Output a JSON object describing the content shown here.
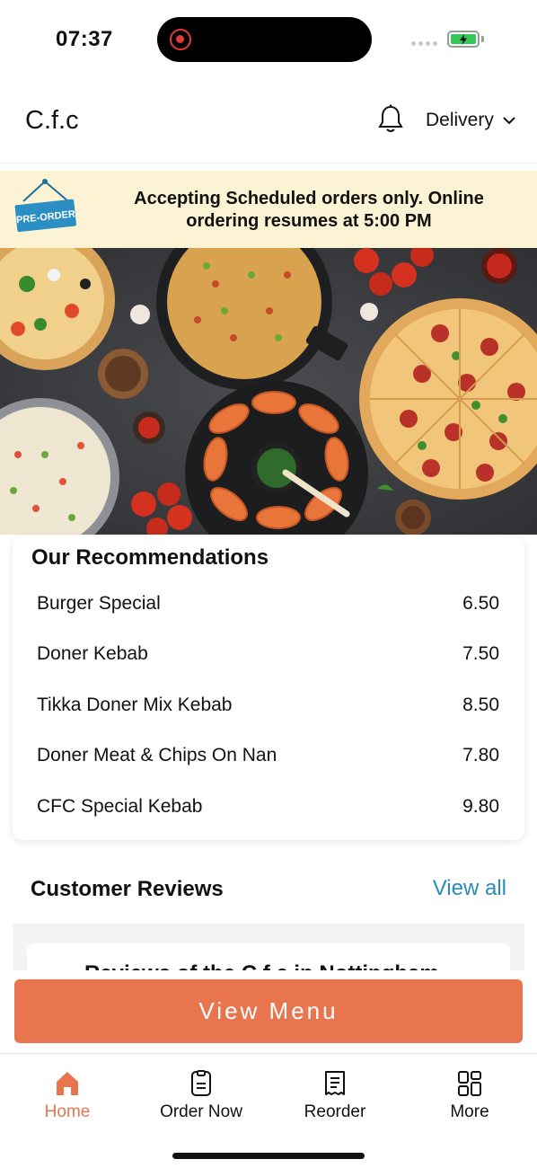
{
  "status_bar": {
    "time": "07:37",
    "battery_level": 1.0,
    "battery_color": "#34c759"
  },
  "header": {
    "brand": "C.f.c",
    "bell_icon": "bell-icon",
    "delivery_label": "Delivery",
    "chevron_icon": "chevron-down-icon"
  },
  "banner": {
    "sign_label": "PRE-ORDER",
    "message": "Accepting Scheduled orders only. Online ordering resumes at 5:00 PM",
    "background": "#fbf3d3"
  },
  "recommendations": {
    "title": "Our Recommendations",
    "items": [
      {
        "name": "Burger Special",
        "price": "6.50"
      },
      {
        "name": "Doner Kebab",
        "price": "7.50"
      },
      {
        "name": "Tikka Doner Mix Kebab",
        "price": "8.50"
      },
      {
        "name": "Doner Meat & Chips On Nan",
        "price": "7.80"
      },
      {
        "name": "CFC Special Kebab",
        "price": "9.80"
      }
    ]
  },
  "reviews": {
    "title": "Customer Reviews",
    "view_all": "View all",
    "peek_text": "Reviews of the C.f.c in Nottingham"
  },
  "view_menu": {
    "label": "View Menu",
    "color": "#e8754e"
  },
  "bottom_nav": {
    "items": [
      {
        "label": "Home",
        "icon": "home-icon",
        "active": true
      },
      {
        "label": "Order Now",
        "icon": "order-icon",
        "active": false
      },
      {
        "label": "Reorder",
        "icon": "receipt-icon",
        "active": false
      },
      {
        "label": "More",
        "icon": "grid-icon",
        "active": false
      }
    ],
    "accent": "#e8754e"
  }
}
